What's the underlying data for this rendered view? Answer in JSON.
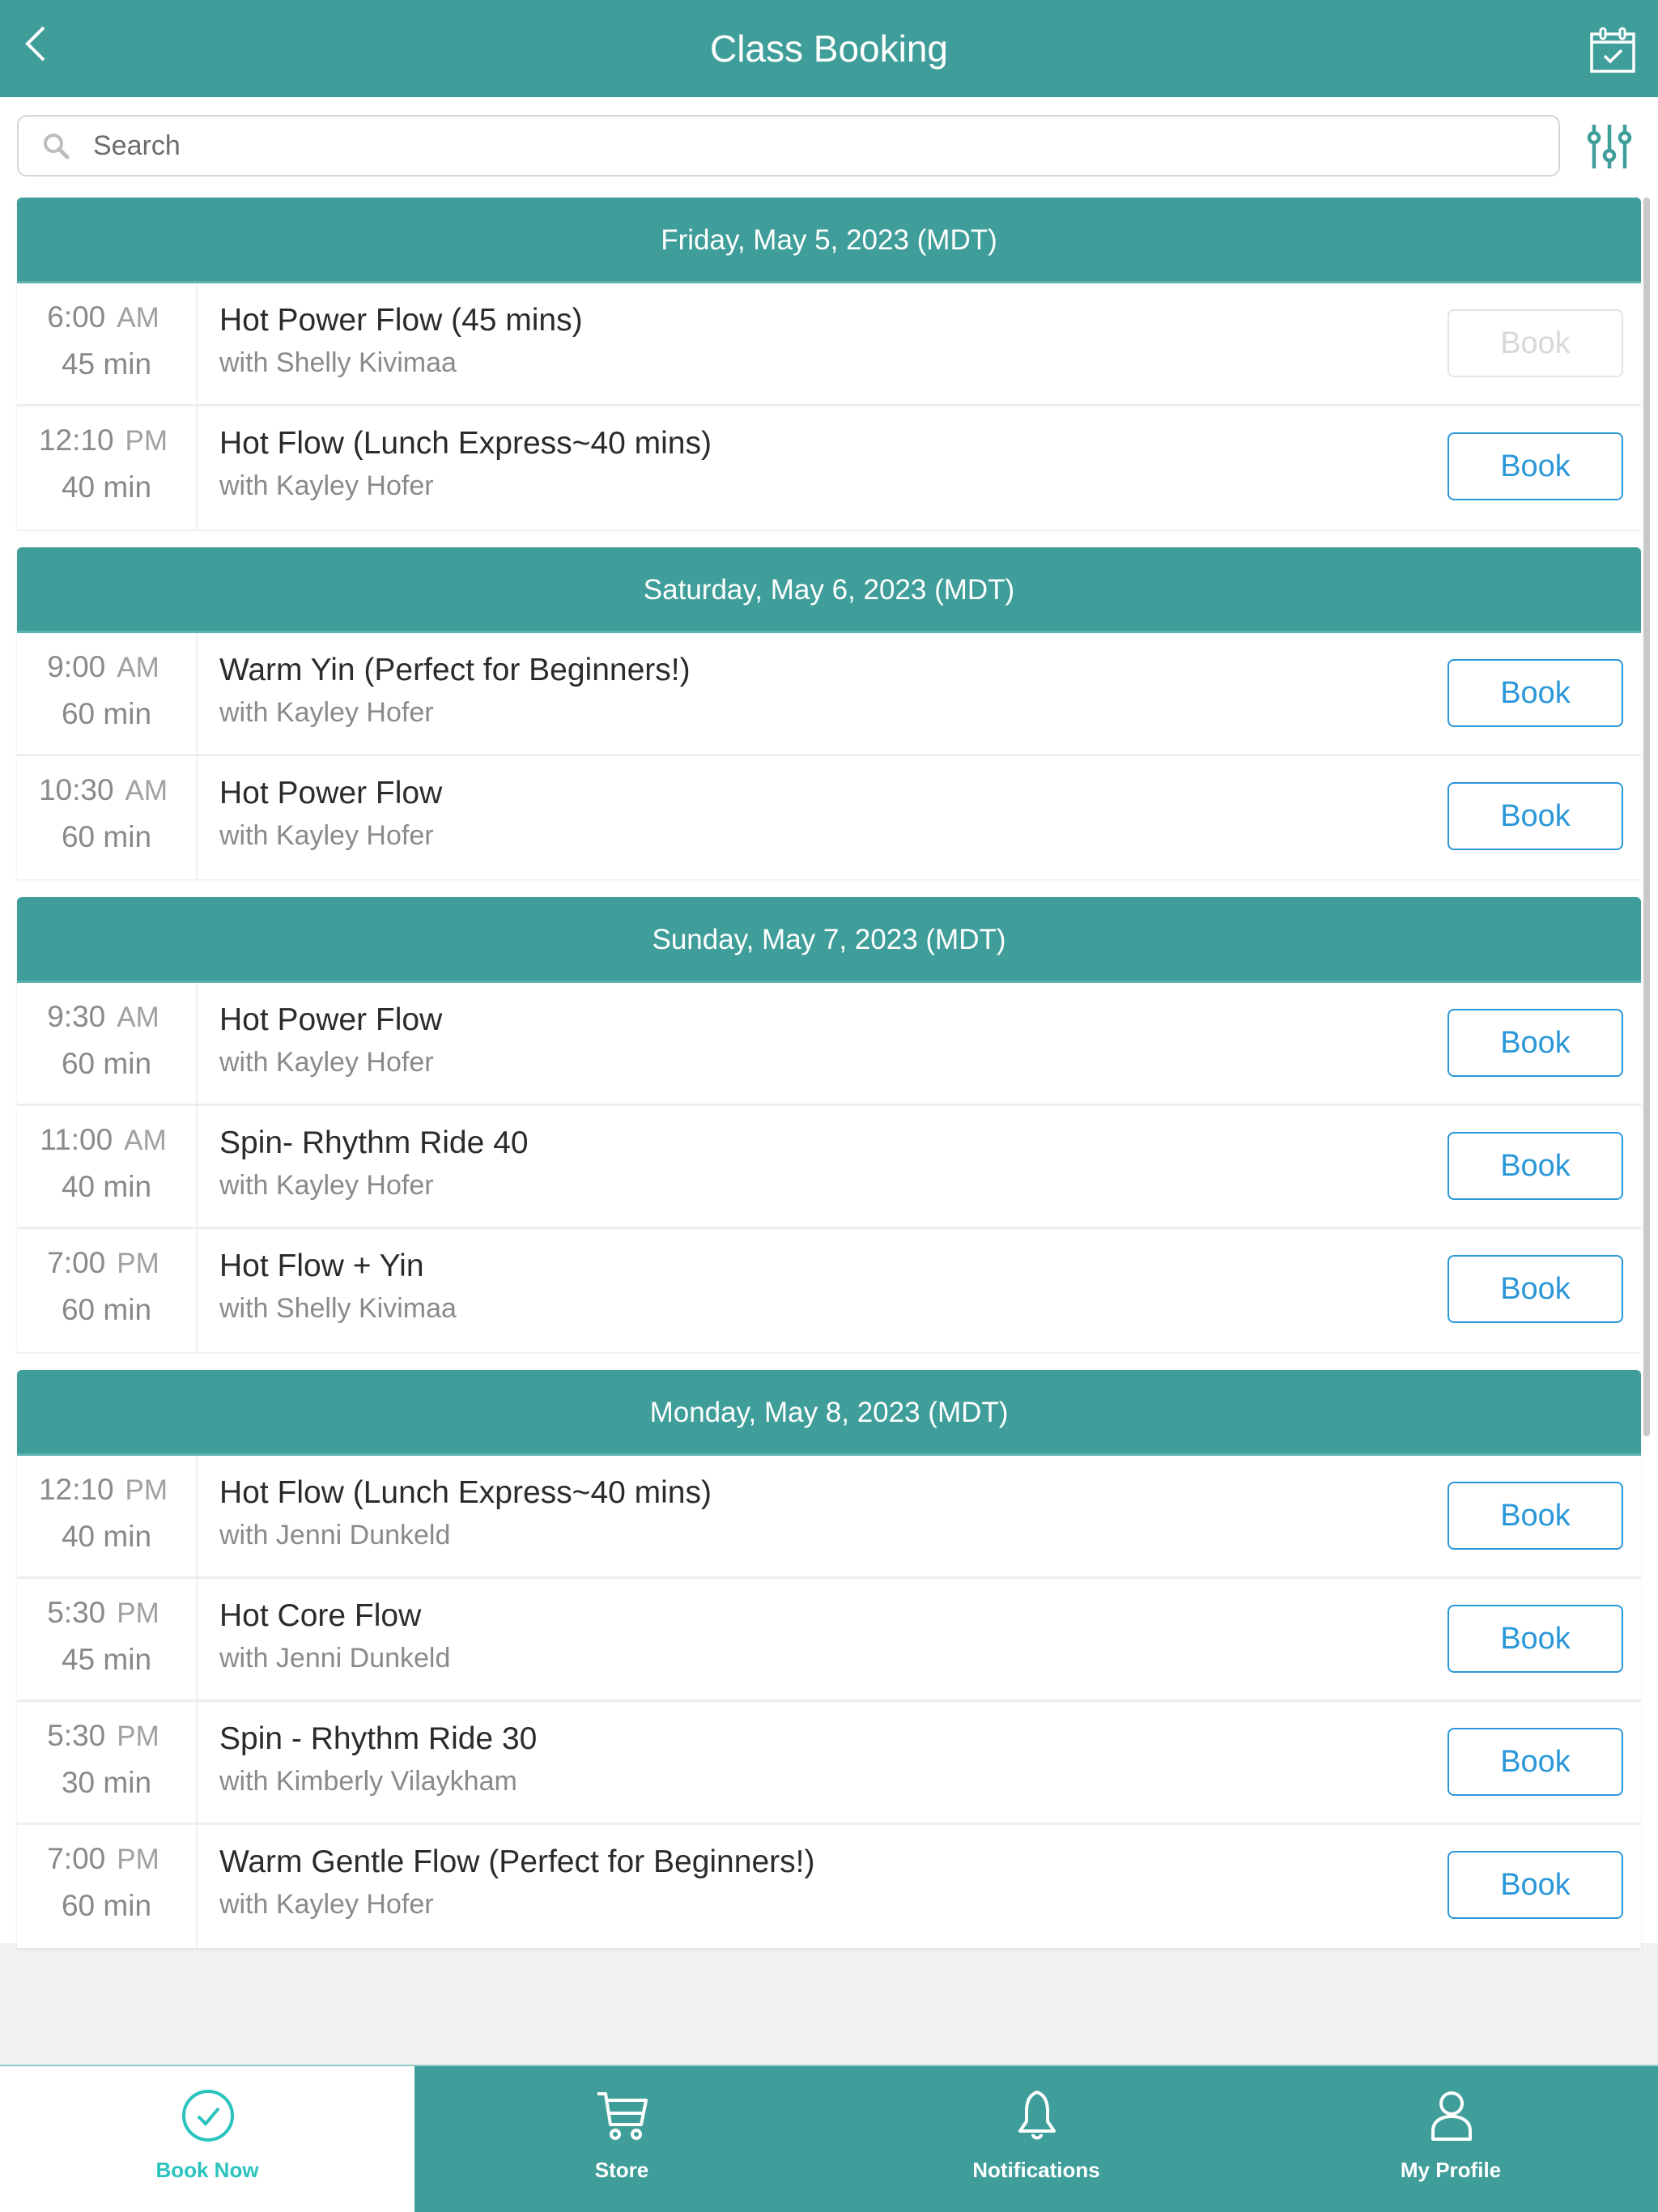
{
  "header": {
    "title": "Class Booking",
    "back_icon": "chevron-left-icon",
    "calendar_icon": "calendar-check-icon"
  },
  "search": {
    "placeholder": "Search",
    "value": "",
    "icon": "search-icon",
    "filter_icon": "sliders-icon"
  },
  "colors": {
    "primary": "#3f9e9a",
    "book_button": "#2a97d8",
    "active_tab": "#2bc3bd"
  },
  "days": [
    {
      "header": "Friday, May 5, 2023 (MDT)",
      "classes": [
        {
          "time": "6:00",
          "ampm": "AM",
          "duration": "45 min",
          "name": "Hot Power Flow (45 mins)",
          "instructor": "with Shelly Kivimaa",
          "button": "Book",
          "disabled": true
        },
        {
          "time": "12:10",
          "ampm": "PM",
          "duration": "40 min",
          "name": "Hot Flow (Lunch Express~40 mins)",
          "instructor": "with Kayley Hofer",
          "button": "Book",
          "disabled": false
        }
      ]
    },
    {
      "header": "Saturday, May 6, 2023 (MDT)",
      "classes": [
        {
          "time": "9:00",
          "ampm": "AM",
          "duration": "60 min",
          "name": "Warm Yin (Perfect for Beginners!)",
          "instructor": "with Kayley Hofer",
          "button": "Book",
          "disabled": false
        },
        {
          "time": "10:30",
          "ampm": "AM",
          "duration": "60 min",
          "name": "Hot Power Flow",
          "instructor": "with Kayley Hofer",
          "button": "Book",
          "disabled": false
        }
      ]
    },
    {
      "header": "Sunday, May 7, 2023 (MDT)",
      "classes": [
        {
          "time": "9:30",
          "ampm": "AM",
          "duration": "60 min",
          "name": "Hot Power Flow",
          "instructor": "with Kayley Hofer",
          "button": "Book",
          "disabled": false
        },
        {
          "time": "11:00",
          "ampm": "AM",
          "duration": "40 min",
          "name": "Spin- Rhythm Ride 40",
          "instructor": "with Kayley Hofer",
          "button": "Book",
          "disabled": false
        },
        {
          "time": "7:00",
          "ampm": "PM",
          "duration": "60 min",
          "name": "Hot Flow + Yin",
          "instructor": "with Shelly Kivimaa",
          "button": "Book",
          "disabled": false
        }
      ]
    },
    {
      "header": "Monday, May 8, 2023 (MDT)",
      "classes": [
        {
          "time": "12:10",
          "ampm": "PM",
          "duration": "40 min",
          "name": "Hot Flow (Lunch Express~40 mins)",
          "instructor": "with Jenni Dunkeld",
          "button": "Book",
          "disabled": false
        },
        {
          "time": "5:30",
          "ampm": "PM",
          "duration": "45 min",
          "name": "Hot Core Flow",
          "instructor": "with Jenni Dunkeld",
          "button": "Book",
          "disabled": false
        },
        {
          "time": "5:30",
          "ampm": "PM",
          "duration": "30 min",
          "name": "Spin - Rhythm Ride 30",
          "instructor": "with Kimberly Vilaykham",
          "button": "Book",
          "disabled": false
        },
        {
          "time": "7:00",
          "ampm": "PM",
          "duration": "60 min",
          "name": "Warm Gentle Flow (Perfect for Beginners!)",
          "instructor": "with Kayley Hofer",
          "button": "Book",
          "disabled": false
        }
      ]
    }
  ],
  "tabbar": {
    "tabs": [
      {
        "label": "Book Now",
        "icon": "check-circle-icon",
        "active": true
      },
      {
        "label": "Store",
        "icon": "cart-icon",
        "active": false
      },
      {
        "label": "Notifications",
        "icon": "bell-icon",
        "active": false
      },
      {
        "label": "My Profile",
        "icon": "user-icon",
        "active": false
      }
    ]
  }
}
